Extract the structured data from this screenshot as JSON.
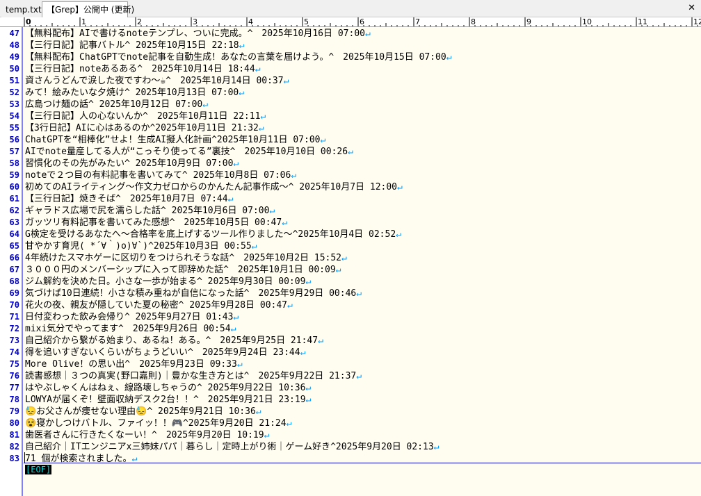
{
  "tabs": [
    {
      "label": "temp.txt"
    },
    {
      "label": "【Grep】公開中 (更新)"
    }
  ],
  "close_symbol": "✕",
  "ruler_labels": [
    "0",
    "1",
    "2",
    "3",
    "4",
    "5",
    "6",
    "7",
    "8",
    "9",
    "10",
    "11",
    "12"
  ],
  "lines": [
    {
      "num": "47",
      "text": "【無料配布】AIで書けるnoteテンプレ、ついに完成。^　2025年10月16日 07:00"
    },
    {
      "num": "48",
      "text": "【三行日記】記事バトル^ 2025年10月15日 22:18"
    },
    {
      "num": "49",
      "text": "【無料配布】ChatGPTでnote記事を自動生成！あなたの言葉を届けよう。^　2025年10月15日 07:00"
    },
    {
      "num": "50",
      "text": "【三行日記】noteあるある^　2025年10月14日 18:44"
    },
    {
      "num": "51",
      "text": "資さんうどんで涙した夜ですわ〜☕^　2025年10月14日 00:37"
    },
    {
      "num": "52",
      "text": "みて！絵みたいな夕焼け^ 2025年10月13日 07:00"
    },
    {
      "num": "53",
      "text": "広島つけ麺の話^ 2025年10月12日 07:00"
    },
    {
      "num": "54",
      "text": "【三行日記】人の心ないんか^　2025年10月11日 22:11"
    },
    {
      "num": "55",
      "text": "【3行日記】AIに心はあるのか^2025年10月11日 21:32"
    },
    {
      "num": "56",
      "text": "ChatGPTを“相棒化”せよ！生成AI擬人化計画^2025年10月11日 07:00"
    },
    {
      "num": "57",
      "text": "AIでnote量産してる人が“こっそり使ってる”裏技^　2025年10月10日 00:26"
    },
    {
      "num": "58",
      "text": "習慣化のその先がみたい^ 2025年10月9日 07:00"
    },
    {
      "num": "59",
      "text": "noteで２つ目の有料記事を書いてみて^ 2025年10月8日 07:06"
    },
    {
      "num": "60",
      "text": "初めてのAIライティング〜作文力ゼロからのかんたん記事作成〜^ 2025年10月7日 12:00"
    },
    {
      "num": "61",
      "text": "【三行日記】焼きそば^　2025年10月7日 07:44"
    },
    {
      "num": "62",
      "text": "ギャラドス広場で尻を濡らした話^ 2025年10月6日 07:00"
    },
    {
      "num": "63",
      "text": "ガッツリ有料記事を書いてみた感想^　2025年10月5日 00:47"
    },
    {
      "num": "64",
      "text": "G検定を受けるあなたへ〜合格率を底上げするツール作りました〜^2025年10月4日 02:52"
    },
    {
      "num": "65",
      "text": "甘やかす育児( *´∀｀)o)∀`)^2025年10月3日 00:55"
    },
    {
      "num": "66",
      "text": "4年続けたスマホゲーに区切りをつけられそうな話^　2025年10月2日 15:52"
    },
    {
      "num": "67",
      "text": "３０００円のメンバーシップに入って即辞めた話^　2025年10月1日 00:09"
    },
    {
      "num": "68",
      "text": "ジム解約を決めた日。小さな一歩が始まる^ 2025年9月30日 00:09"
    },
    {
      "num": "69",
      "text": "気づけば10日連続！小さな積み重ねが自信になった話^　2025年9月29日 00:46"
    },
    {
      "num": "70",
      "text": "花火の夜、親友が隠していた夏の秘密^ 2025年9月28日 00:47"
    },
    {
      "num": "71",
      "text": "日付変わった飲み会帰り^ 2025年9月27日 01:43"
    },
    {
      "num": "72",
      "text": "mixi気分でやってます^　2025年9月26日 00:54"
    },
    {
      "num": "73",
      "text": "自己紹介から繋がる始まり、あるね！ある。^　2025年9月25日 21:47"
    },
    {
      "num": "74",
      "text": "得を追いすぎないくらいがちょうどいい^　2025年9月24日 23:44"
    },
    {
      "num": "75",
      "text": "More Olive！の思い出^　2025年9月23日 09:33"
    },
    {
      "num": "76",
      "text": "読書感想｜３つの真実(野口嘉則)｜豊かな生き方とは^　2025年9月22日 21:37"
    },
    {
      "num": "77",
      "text": "はやぶしゃくんはねぇ、線路壊しちゃうの^ 2025年9月22日 10:36"
    },
    {
      "num": "78",
      "text": "LOWYAが届くぞ！壁面収納デスク2台！！^　2025年9月21日 23:19"
    },
    {
      "num": "79",
      "text": "😓お父さんが痩せない理由😓^ 2025年9月21日 10:36"
    },
    {
      "num": "80",
      "text": "😵寝かしつけバトル、ファイッ！！🎮^2025年9月20日 21:24"
    },
    {
      "num": "81",
      "text": "歯医者さんに行きたくなーい！^　2025年9月20日 10:19"
    },
    {
      "num": "82",
      "text": "自己紹介｜ITエンジニアx三姉妹パパ｜暮らし｜定時上がり術｜ゲーム好き^2025年9月20日 02:13"
    },
    {
      "num": "83",
      "text": "71 個が検索されました。"
    }
  ],
  "eol_mark": "↵",
  "eof_mark": "[EOF]",
  "colors": {
    "line_number": "#0000c8",
    "editor_bg": "#fffcf0",
    "eol_mark": "#00a0ff",
    "eof_fg": "#00e0e0",
    "eof_bg": "#000000"
  }
}
